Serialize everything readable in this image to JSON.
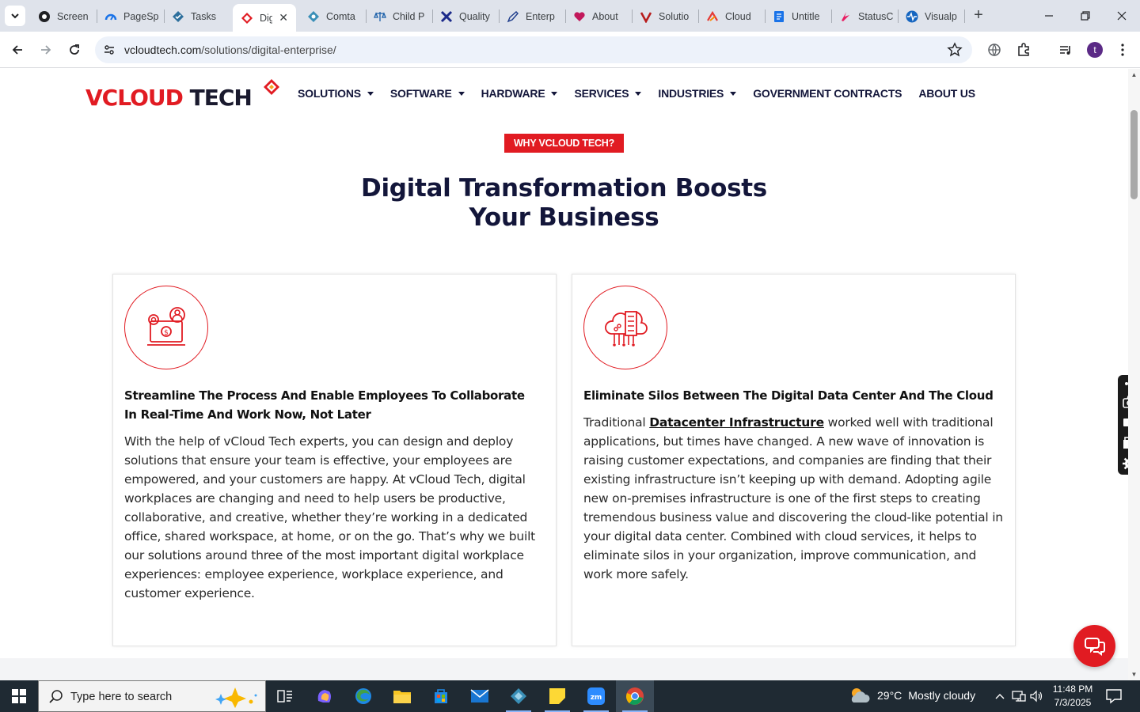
{
  "browser": {
    "tabs": [
      {
        "label": "Screen",
        "icon": "screencast-icon"
      },
      {
        "label": "PageSp",
        "icon": "pagespeed-icon"
      },
      {
        "label": "Tasks",
        "icon": "tasks-icon"
      },
      {
        "label": "Dig",
        "icon": "vcloud-favicon",
        "active": true
      },
      {
        "label": "Comta",
        "icon": "comta-icon"
      },
      {
        "label": "Child P",
        "icon": "scales-icon"
      },
      {
        "label": "Quality",
        "icon": "x-logo-icon"
      },
      {
        "label": "Enterp",
        "icon": "pen-icon"
      },
      {
        "label": "About",
        "icon": "heart-icon"
      },
      {
        "label": "Solutio",
        "icon": "v-logo-icon"
      },
      {
        "label": "Cloud",
        "icon": "cloud-brand-icon"
      },
      {
        "label": "Untitle",
        "icon": "docs-icon"
      },
      {
        "label": "StatusC",
        "icon": "status-icon"
      },
      {
        "label": "Visualp",
        "icon": "pulse-icon"
      }
    ],
    "url_host": "vcloudtech.com",
    "url_path": "/solutions/digital-enterprise/",
    "profile_initial": "t"
  },
  "site": {
    "logo_left": "VCLOUD",
    "logo_right": "TECH",
    "nav": [
      {
        "label": "SOLUTIONS",
        "dropdown": true
      },
      {
        "label": "SOFTWARE",
        "dropdown": true
      },
      {
        "label": "HARDWARE",
        "dropdown": true
      },
      {
        "label": "SERVICES",
        "dropdown": true
      },
      {
        "label": "INDUSTRIES",
        "dropdown": true
      },
      {
        "label": "GOVERNMENT CONTRACTS",
        "dropdown": false
      },
      {
        "label": "ABOUT US",
        "dropdown": false
      }
    ],
    "badge": "WHY VCLOUD TECH?",
    "hero_title": "Digital Transformation Boosts Your Business",
    "cards": [
      {
        "title": "Streamline The Process And Enable Employees To Collaborate In Real-Time And Work Now, Not Later",
        "body": "With the help of vCloud Tech experts, you can design and deploy solutions that ensure your team is effective, your employees are empowered, and your customers are happy. At vCloud Tech, digital workplaces are changing and need to help users be productive, collaborative, and creative, whether they’re working in a dedicated office, shared workspace, at home, or on the go. That’s why we built our solutions around three of the most important digital workplace experiences: employee experience, workplace experience, and customer experience."
      },
      {
        "title": "Eliminate Silos Between The Digital Data Center And The Cloud",
        "body_prefix": "Traditional ",
        "body_link": "Datacenter Infrastructure",
        "body_suffix": " worked well with traditional applications, but times have changed. A new wave of innovation is raising customer expectations, and companies are finding that their existing infrastructure isn’t keeping up with demand. Adopting agile new on-premises infrastructure is one of the first steps to creating tremendous business value and discovering the cloud-like potential in your digital data center. Combined with cloud services, it helps to eliminate silos in your organization, improve communication, and work more safely."
      }
    ]
  },
  "taskbar": {
    "search_placeholder": "Type here to search",
    "weather_temp": "29°C",
    "weather_desc": "Mostly cloudy",
    "time": "11:48 PM",
    "date": "7/3/2025"
  },
  "colors": {
    "brand_red": "#e11b22",
    "navy": "#13163a",
    "taskbar": "#1f2a33"
  }
}
